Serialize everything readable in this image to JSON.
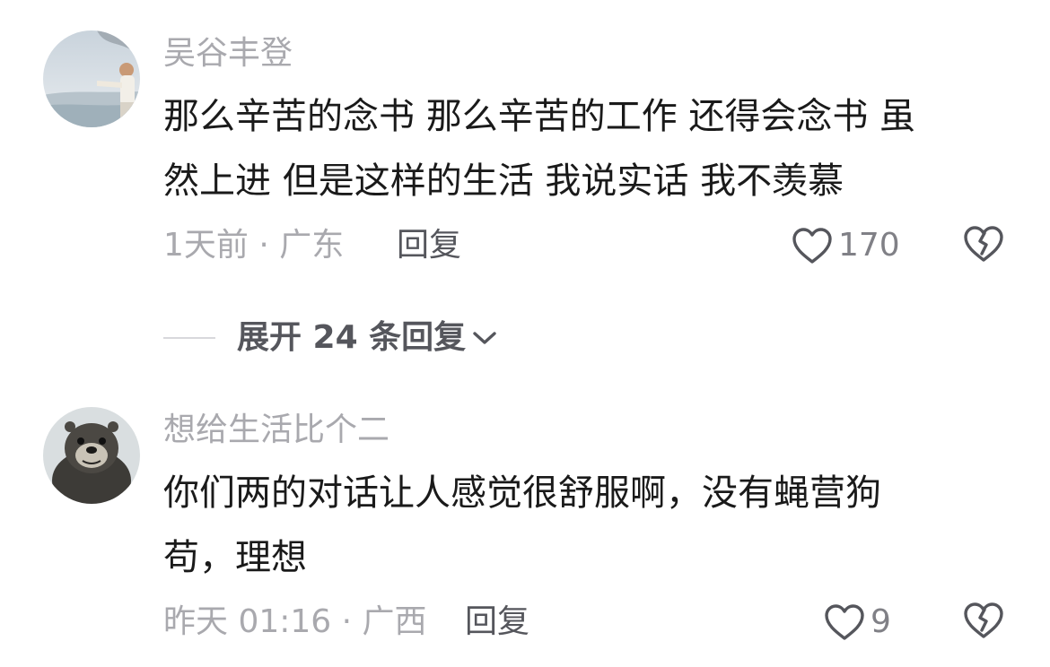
{
  "comments": [
    {
      "username": "吴谷丰登",
      "text": "那么辛苦的念书 那么辛苦的工作 还得会念书 虽\n然上进 但是这样的生活 我说实话 我不羡慕",
      "meta": "1天前 · 广东",
      "reply_label": "回复",
      "like_count": "170",
      "avatar_icon": "avatar-photo-man-seaside",
      "like_icon": "heart-outline-icon",
      "dislike_icon": "broken-heart-icon"
    },
    {
      "username": "想给生活比个二",
      "text": "你们两的对话让人感觉很舒服啊，没有蝇营狗\n苟，理想",
      "meta": "昨天 01:16 · 广西",
      "reply_label": "回复",
      "like_count": "9",
      "avatar_icon": "avatar-photo-otter",
      "like_icon": "heart-outline-icon",
      "dislike_icon": "broken-heart-icon"
    }
  ],
  "replies_toggle": {
    "label": "展开 24 条回复",
    "icon": "chevron-down-icon"
  },
  "colors": {
    "secondary_text": "#a9a9ae",
    "primary_text": "#1a1a1a",
    "action_text": "#55565c"
  }
}
